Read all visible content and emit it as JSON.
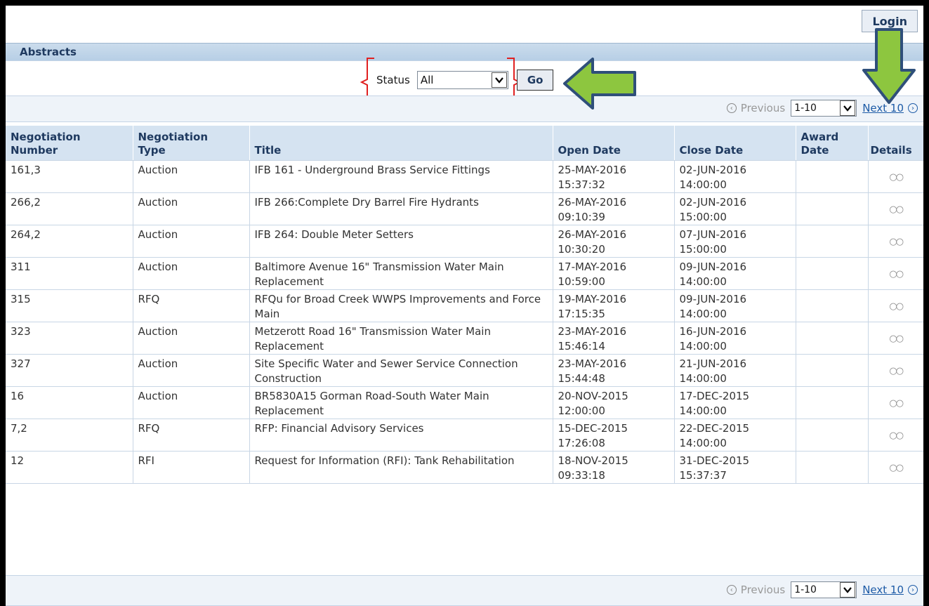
{
  "header": {
    "login_label": "Login"
  },
  "section": {
    "title": "Abstracts"
  },
  "filter": {
    "status_label": "Status",
    "status_value": "All",
    "go_label": "Go"
  },
  "pagination": {
    "previous_label": "Previous",
    "range_value": "1-10",
    "next_label": "Next 10"
  },
  "table": {
    "columns": [
      {
        "line1": "Negotiation",
        "line2": "Number"
      },
      {
        "line1": "Negotiation",
        "line2": "Type"
      },
      {
        "line1": "",
        "line2": "Title"
      },
      {
        "line1": "",
        "line2": "Open Date"
      },
      {
        "line1": "",
        "line2": "Close Date"
      },
      {
        "line1": "Award",
        "line2": "Date"
      },
      {
        "line1": "",
        "line2": "Details"
      }
    ],
    "rows": [
      {
        "number": "161,3",
        "type": "Auction",
        "title": "IFB 161 - Underground Brass Service Fittings",
        "open_date": "25-MAY-2016",
        "open_time": "15:37:32",
        "close_date": "02-JUN-2016",
        "close_time": "14:00:00",
        "award_date": ""
      },
      {
        "number": "266,2",
        "type": "Auction",
        "title": "IFB 266:Complete Dry Barrel Fire Hydrants",
        "open_date": "26-MAY-2016",
        "open_time": "09:10:39",
        "close_date": "02-JUN-2016",
        "close_time": "15:00:00",
        "award_date": ""
      },
      {
        "number": "264,2",
        "type": "Auction",
        "title": "IFB 264: Double Meter Setters",
        "open_date": "26-MAY-2016",
        "open_time": "10:30:20",
        "close_date": "07-JUN-2016",
        "close_time": "15:00:00",
        "award_date": ""
      },
      {
        "number": "311",
        "type": "Auction",
        "title": "Baltimore Avenue 16\" Transmission Water Main Replacement",
        "open_date": "17-MAY-2016",
        "open_time": "10:59:00",
        "close_date": "09-JUN-2016",
        "close_time": "14:00:00",
        "award_date": ""
      },
      {
        "number": "315",
        "type": "RFQ",
        "title": "RFQu for Broad Creek WWPS Improvements and Force Main",
        "open_date": "19-MAY-2016",
        "open_time": "17:15:35",
        "close_date": "09-JUN-2016",
        "close_time": "14:00:00",
        "award_date": ""
      },
      {
        "number": "323",
        "type": "Auction",
        "title": "Metzerott Road 16\" Transmission Water Main Replacement",
        "open_date": "23-MAY-2016",
        "open_time": "15:46:14",
        "close_date": "16-JUN-2016",
        "close_time": "14:00:00",
        "award_date": ""
      },
      {
        "number": "327",
        "type": "Auction",
        "title": "Site Specific Water and Sewer Service Connection Construction",
        "open_date": "23-MAY-2016",
        "open_time": "15:44:48",
        "close_date": "21-JUN-2016",
        "close_time": "14:00:00",
        "award_date": ""
      },
      {
        "number": "16",
        "type": "Auction",
        "title": "BR5830A15 Gorman Road-South Water Main Replacement",
        "open_date": "20-NOV-2015",
        "open_time": "12:00:00",
        "close_date": "17-DEC-2015",
        "close_time": "14:00:00",
        "award_date": ""
      },
      {
        "number": "7,2",
        "type": "RFQ",
        "title": "RFP: Financial Advisory Services",
        "open_date": "15-DEC-2015",
        "open_time": "17:26:08",
        "close_date": "22-DEC-2015",
        "close_time": "14:00:00",
        "award_date": ""
      },
      {
        "number": "12",
        "type": "RFI",
        "title": "Request for Information (RFI): Tank Rehabilitation",
        "open_date": "18-NOV-2015",
        "open_time": "09:33:18",
        "close_date": "31-DEC-2015",
        "close_time": "15:37:37",
        "award_date": ""
      }
    ]
  },
  "icons": {
    "details": "glasses-icon",
    "previous": "chevron-left-circle-icon",
    "next": "chevron-right-circle-icon",
    "dropdown": "chevron-down-icon"
  },
  "colors": {
    "header_bar": "#b7cfe6",
    "table_header": "#d5e3f1",
    "link": "#1c5aa6",
    "annotation_arrow": "#8dc63f",
    "annotation_bracket": "#e02020"
  }
}
